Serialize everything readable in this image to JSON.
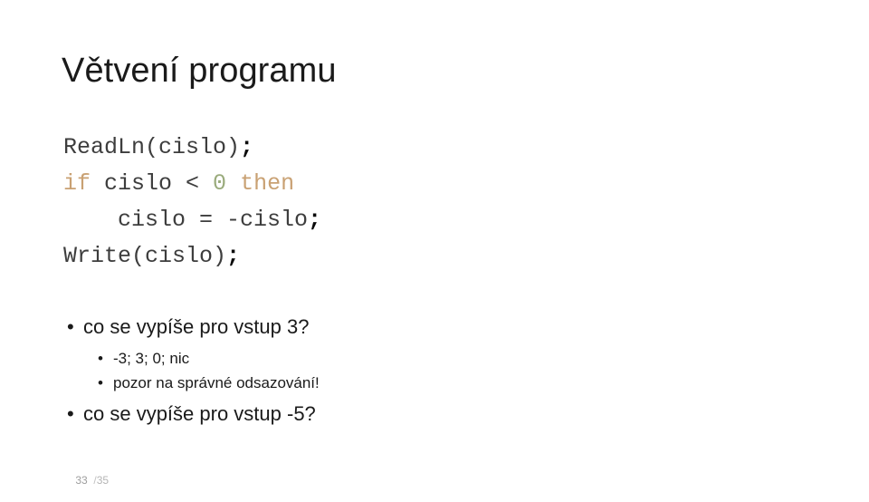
{
  "slide": {
    "title": "Větvení programu",
    "code": {
      "language": "pascal",
      "lines": [
        {
          "tokens": [
            {
              "text": "ReadLn(cislo)",
              "type": "plain"
            },
            {
              "text": ";",
              "type": "punct"
            }
          ]
        },
        {
          "tokens": [
            {
              "text": "if",
              "type": "keyword"
            },
            {
              "text": " cislo < ",
              "type": "plain"
            },
            {
              "text": "0",
              "type": "number"
            },
            {
              "text": " ",
              "type": "plain"
            },
            {
              "text": "then",
              "type": "keyword"
            }
          ]
        },
        {
          "tokens": [
            {
              "text": "    cislo = -cislo",
              "type": "plain"
            },
            {
              "text": ";",
              "type": "punct"
            }
          ]
        },
        {
          "tokens": [
            {
              "text": "Write(cislo)",
              "type": "plain"
            },
            {
              "text": ";",
              "type": "punct"
            }
          ]
        }
      ]
    },
    "bullets": [
      {
        "marker": "•",
        "text": "co se vypíše pro vstup 3?",
        "children": [
          {
            "marker": "•",
            "text": "-3; 3; 0; nic"
          },
          {
            "marker": "•",
            "text": "pozor na správné odsazování!"
          }
        ]
      },
      {
        "marker": "•",
        "text": "co se vypíše pro vstup -5?",
        "children": []
      }
    ],
    "footer": {
      "page_current": "33",
      "page_separator": "/",
      "page_total": "35"
    }
  },
  "colors": {
    "background": "#ffffff",
    "text": "#1a1a1a",
    "code_plain": "#3d3d3d",
    "code_keyword": "#c9a173",
    "code_number": "#9aab7c",
    "code_punct": "#0a0a0a",
    "footer": "#b5b5b5"
  }
}
